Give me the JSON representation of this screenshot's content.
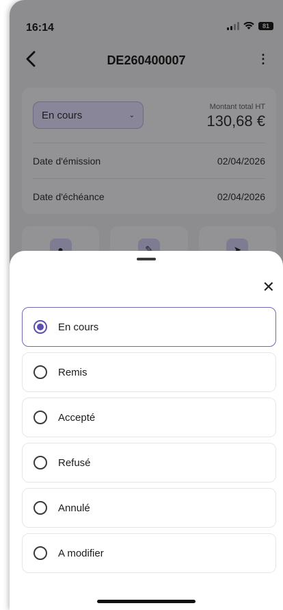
{
  "status_bar": {
    "time": "16:14",
    "battery": "81"
  },
  "header": {
    "back_icon": "chevron-left-icon",
    "title": "DE260400007",
    "more_icon": "vertical-dots-icon"
  },
  "summary": {
    "status_value": "En cours",
    "amount_label": "Montant total HT",
    "amount_value": "130,68 €",
    "rows": [
      {
        "label": "Date d'émission",
        "value": "02/04/2026"
      },
      {
        "label": "Date d'échéance",
        "value": "02/04/2026"
      }
    ]
  },
  "actions": [
    {
      "icon": "eye-icon",
      "glyph": "●"
    },
    {
      "icon": "pencil-icon",
      "glyph": "✎"
    },
    {
      "icon": "send-icon",
      "glyph": "➤"
    }
  ],
  "sheet": {
    "close_icon": "close-icon",
    "options": [
      {
        "label": "En cours",
        "selected": true
      },
      {
        "label": "Remis",
        "selected": false
      },
      {
        "label": "Accepté",
        "selected": false
      },
      {
        "label": "Refusé",
        "selected": false
      },
      {
        "label": "Annulé",
        "selected": false
      },
      {
        "label": "A modifier",
        "selected": false
      }
    ]
  },
  "colors": {
    "accent": "#5b50b0",
    "overlay": "#8d8d8f"
  }
}
